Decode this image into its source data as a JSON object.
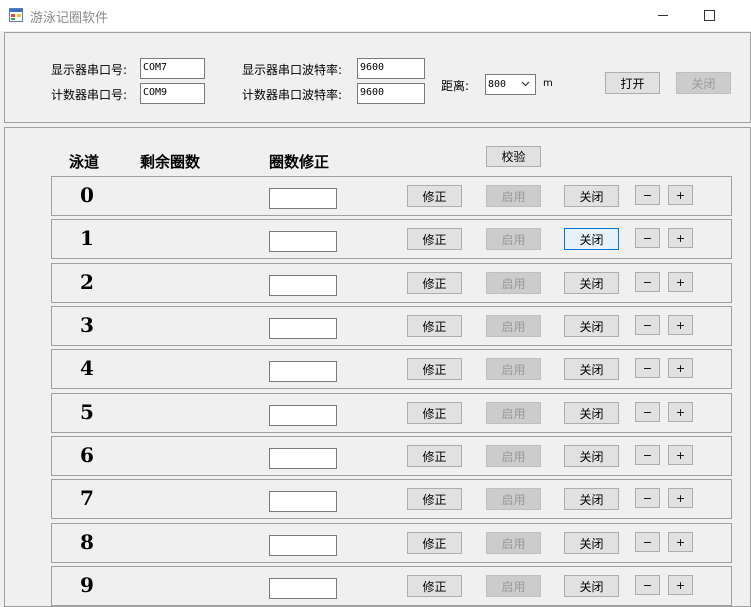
{
  "window": {
    "title": "游泳记圈软件"
  },
  "config": {
    "display_port_label": "显示器串口号:",
    "display_port_value": "COM7",
    "counter_port_label": "计数器串口号:",
    "counter_port_value": "COM9",
    "display_baud_label": "显示器串口波特率:",
    "display_baud_value": "9600",
    "counter_baud_label": "计数器串口波特率:",
    "counter_baud_value": "9600",
    "distance_label": "距离:",
    "distance_value": "800",
    "distance_unit": "m",
    "open_label": "打开",
    "close_label": "关闭"
  },
  "table": {
    "col_lane": "泳道",
    "col_remaining": "剩余圈数",
    "col_correction": "圈数修正",
    "verify_label": "校验"
  },
  "lane_buttons": {
    "fix": "修正",
    "enable": "启用",
    "close": "关闭",
    "minus": "−",
    "plus": "+"
  },
  "lanes": [
    {
      "number": "0",
      "remaining": "",
      "correction": ""
    },
    {
      "number": "1",
      "remaining": "",
      "correction": ""
    },
    {
      "number": "2",
      "remaining": "",
      "correction": ""
    },
    {
      "number": "3",
      "remaining": "",
      "correction": ""
    },
    {
      "number": "4",
      "remaining": "",
      "correction": ""
    },
    {
      "number": "5",
      "remaining": "",
      "correction": ""
    },
    {
      "number": "6",
      "remaining": "",
      "correction": ""
    },
    {
      "number": "7",
      "remaining": "",
      "correction": ""
    },
    {
      "number": "8",
      "remaining": "",
      "correction": ""
    },
    {
      "number": "9",
      "remaining": "",
      "correction": ""
    }
  ],
  "icons": {
    "app": "app-form-icon",
    "minimize": "minimize-icon",
    "maximize": "maximize-icon",
    "dropdown": "chevron-down-icon"
  }
}
